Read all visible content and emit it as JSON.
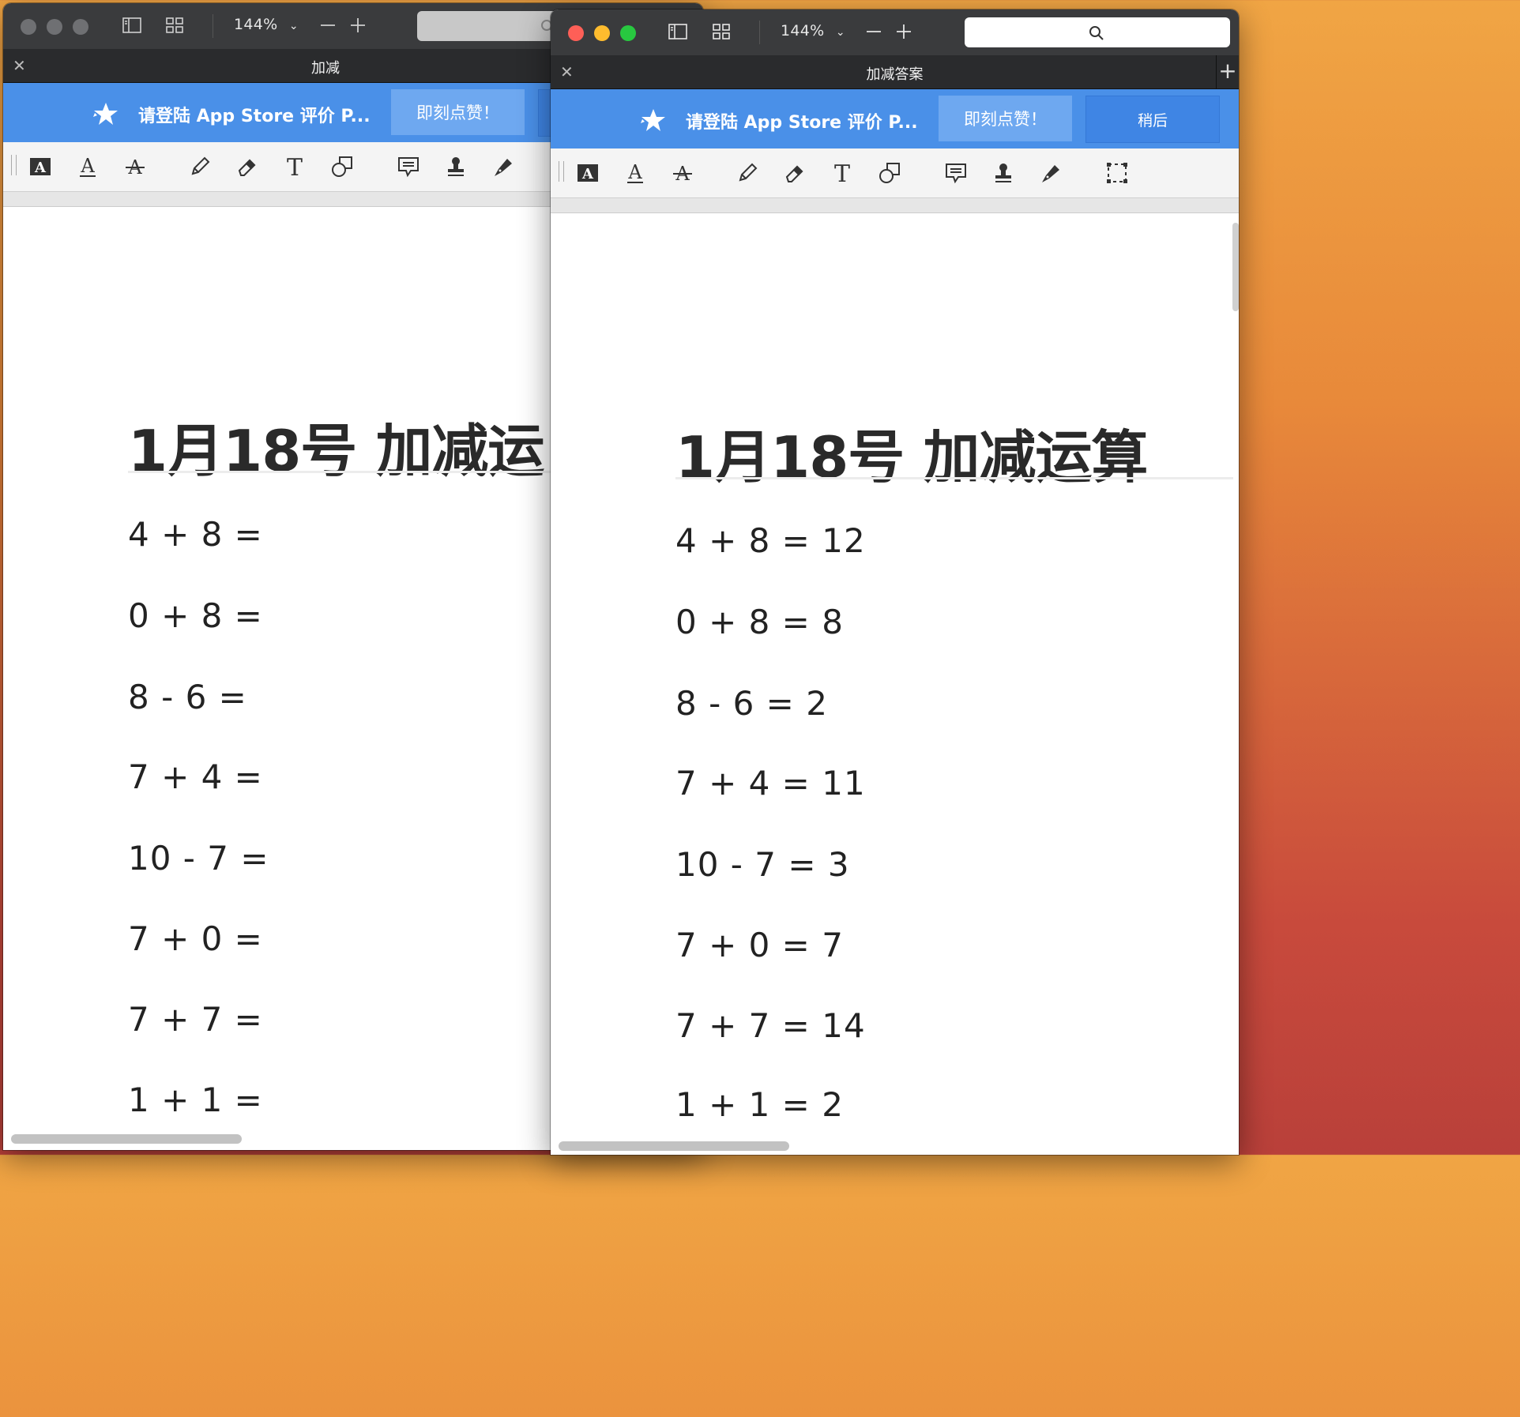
{
  "back_window": {
    "zoom": "144%",
    "tab_title": "加减",
    "banner": {
      "text": "请登陆 App Store 评价 P...",
      "rate_button": "即刻点赞！"
    },
    "document": {
      "title": "1月18号 加减运",
      "problems": [
        "4 + 8 =",
        "0 + 8 =",
        "8 - 6 =",
        "7 + 4 =",
        "10 - 7 =",
        "7 + 0 =",
        "7 + 7 =",
        "1 + 1 ="
      ]
    }
  },
  "front_window": {
    "zoom": "144%",
    "tab_title": "加减答案",
    "banner": {
      "text": "请登陆 App Store 评价 P...",
      "rate_button": "即刻点赞！",
      "later_button": "稍后"
    },
    "document": {
      "title": "1月18号 加减运算",
      "problems": [
        "4 + 8 = 12",
        "0 + 8 = 8",
        "8 - 6 = 2",
        "7 + 4 = 11",
        "10 - 7 = 3",
        "7 + 0 = 7",
        "7 + 7 = 14",
        "1 + 1 = 2"
      ]
    }
  },
  "toolbar_icons": [
    "text-format-icon",
    "underline-text-icon",
    "strikethrough-text-icon",
    "pencil-icon",
    "eraser-icon",
    "text-tool-icon",
    "shapes-icon",
    "comment-icon",
    "stamp-icon",
    "pen-icon",
    "selection-icon"
  ],
  "colors": {
    "banner": "#4a90e8",
    "rate_button": "#6ea8f0",
    "later_button": "#3f85e4",
    "titlebar": "#3a3b3d"
  }
}
